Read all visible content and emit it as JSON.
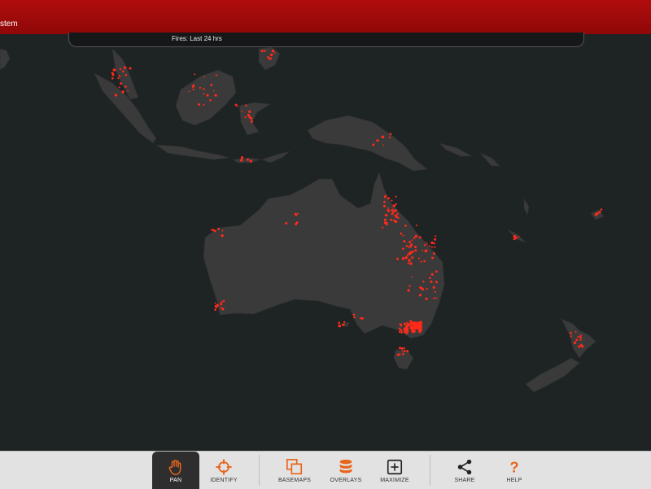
{
  "header": {
    "title": "stem"
  },
  "legend": {
    "label": "Fires: Last 24 hrs"
  },
  "colors": {
    "accent": "#e8641c",
    "land": "#3a3a3a",
    "water": "#1e2324",
    "fire": "#ff2a1a",
    "header": "#a10b0b"
  },
  "toolbar": {
    "pan": {
      "label": "PAN",
      "icon": "hand-icon",
      "active": true
    },
    "identify": {
      "label": "IDENTIFY",
      "icon": "crosshair-icon"
    },
    "basemaps": {
      "label": "BASEMAPS",
      "icon": "layers-icon"
    },
    "overlays": {
      "label": "OVERLAYS",
      "icon": "database-icon"
    },
    "maximize": {
      "label": "MAXIMIZE",
      "icon": "plus-square-icon"
    },
    "share": {
      "label": "SHARE",
      "icon": "share-icon"
    },
    "help": {
      "label": "HELP",
      "icon": "question-icon"
    }
  }
}
